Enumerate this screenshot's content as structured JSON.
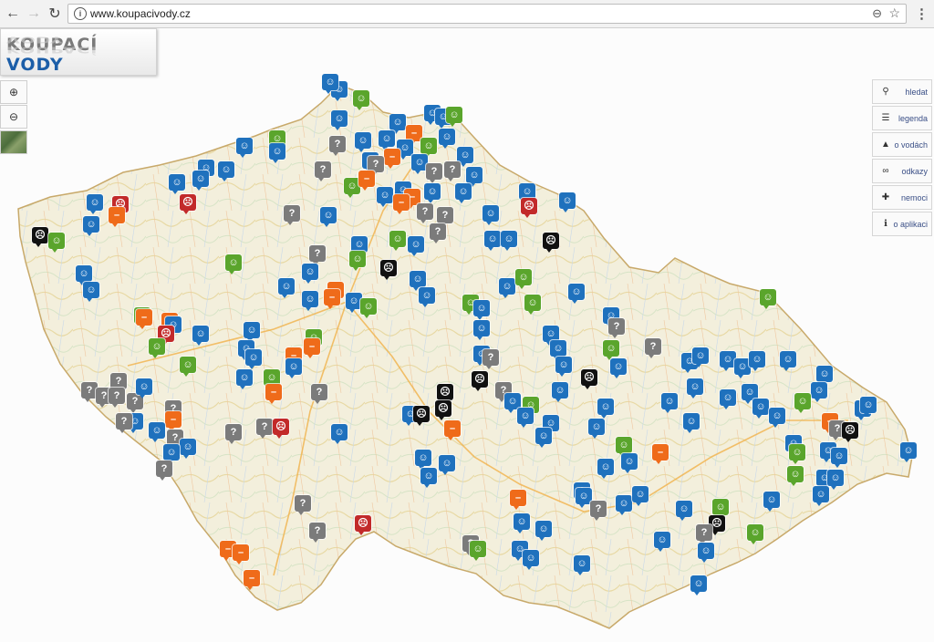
{
  "browser": {
    "url": "www.koupacivody.cz",
    "back_icon": "←",
    "forward_icon": "→",
    "reload_icon": "↻",
    "zoom_icon": "⊖",
    "star_icon": "☆",
    "menu_icon": "⋮",
    "info_icon": "i"
  },
  "logo": {
    "part1": "KOUPACÍ ",
    "part2": "VODY"
  },
  "map_tools": {
    "zoom_in": "⊕",
    "zoom_out": "⊖"
  },
  "panel": {
    "items": [
      {
        "icon": "search-icon",
        "glyph": "⚲",
        "label": "hledat"
      },
      {
        "icon": "list-icon",
        "glyph": "☰",
        "label": "legenda"
      },
      {
        "icon": "flask-icon",
        "glyph": "▲",
        "label": "o vodách"
      },
      {
        "icon": "link-icon",
        "glyph": "∞",
        "label": "odkazy"
      },
      {
        "icon": "plus-icon",
        "glyph": "✚",
        "label": "nemoci"
      },
      {
        "icon": "info-icon",
        "glyph": "ℹ",
        "label": "o aplikaci"
      }
    ]
  },
  "marker_glyphs": {
    "blue": "☺",
    "green": "☺",
    "orange": "–",
    "red": "☹",
    "gray": "?",
    "black": "☹"
  },
  "colors": {
    "blue": "#1f71bd",
    "green": "#5aa52c",
    "orange": "#ef6b1a",
    "red": "#c22a2a",
    "gray": "#7b7b7b",
    "black": "#111111"
  }
}
